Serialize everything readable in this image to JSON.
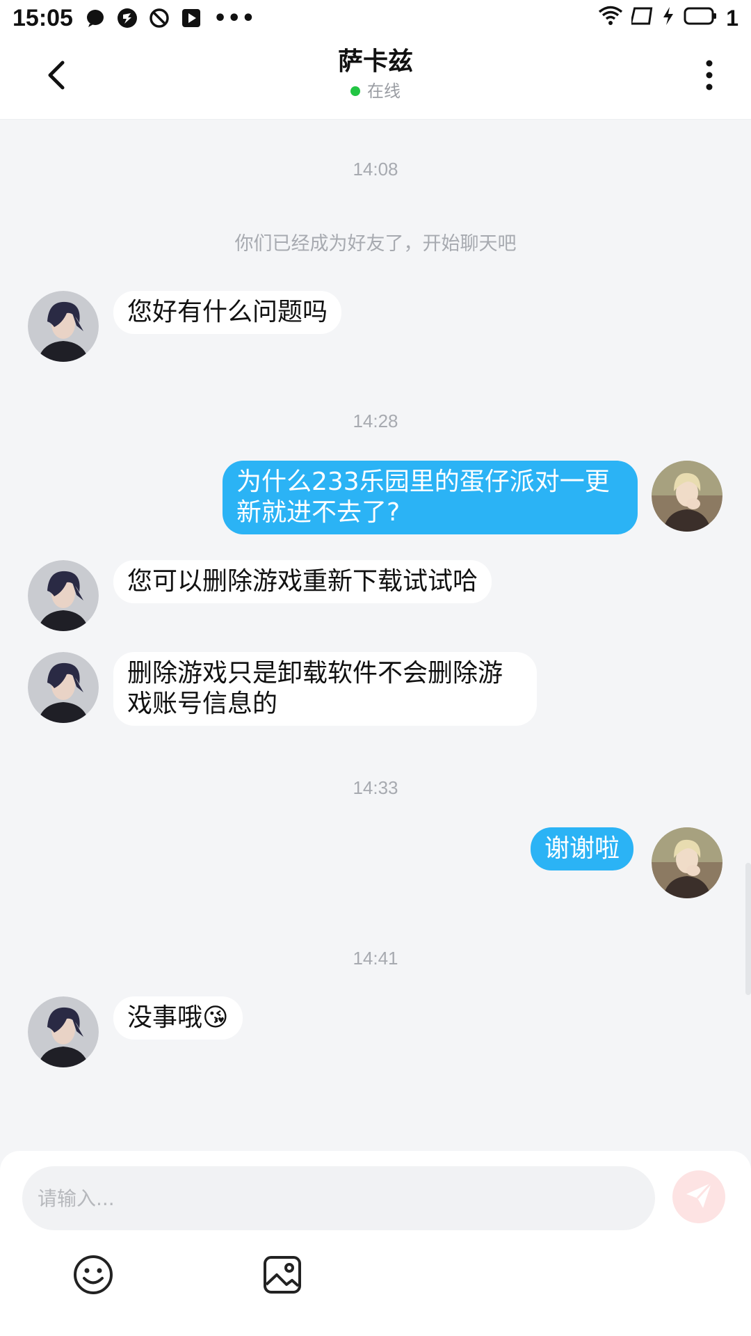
{
  "status_bar": {
    "time": "15:05",
    "battery_text": "1"
  },
  "header": {
    "title": "萨卡兹",
    "presence": "在线"
  },
  "messages": [
    {
      "type": "time",
      "text": "14:08"
    },
    {
      "type": "system",
      "text": "你们已经成为好友了，开始聊天吧"
    },
    {
      "type": "left",
      "text": "您好有什么问题吗"
    },
    {
      "type": "time",
      "text": "14:28"
    },
    {
      "type": "right",
      "line1": "为什么233乐园里的蛋仔派对一更",
      "line2": "新就进不去了?"
    },
    {
      "type": "left",
      "text": "您可以删除游戏重新下载试试哈"
    },
    {
      "type": "left",
      "line1": "删除游戏只是卸载软件不会删除游",
      "line2": "戏账号信息的"
    },
    {
      "type": "time",
      "text": "14:33"
    },
    {
      "type": "right",
      "text": "谢谢啦"
    },
    {
      "type": "time",
      "text": "14:41"
    },
    {
      "type": "left",
      "text": "没事哦",
      "emoji": "😘"
    }
  ],
  "input": {
    "placeholder": "请输入..."
  },
  "icons": {
    "back": "chevron-left-icon",
    "more": "more-vertical-icon",
    "send": "send-icon",
    "emoji": "smiley-icon",
    "image": "image-icon"
  },
  "colors": {
    "accent_bubble": "#2bb3f5",
    "online": "#22c543",
    "background": "#f4f5f7",
    "send_button_disabled": "#fde3e3"
  }
}
